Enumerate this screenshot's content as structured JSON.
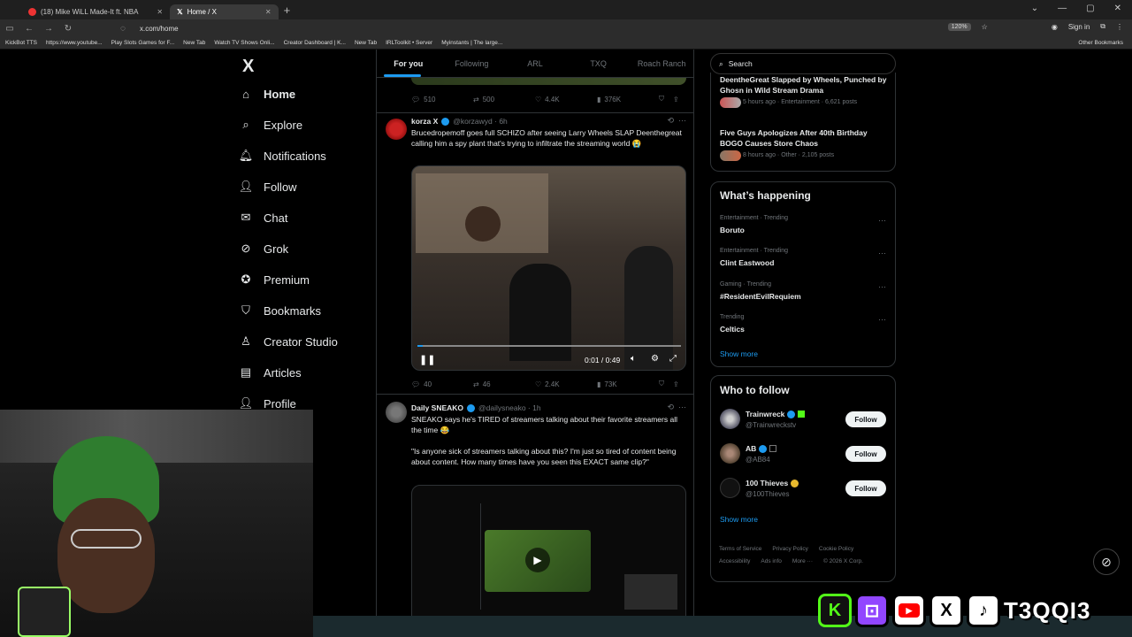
{
  "browser": {
    "tabs": [
      {
        "label": "(18) Mike WiLL Made-It ft. NBA"
      },
      {
        "label": "Home / X"
      }
    ],
    "url": "x.com/home",
    "zoom": "120%",
    "sign_in": "Sign in",
    "bookmarks": [
      "KickBot TTS",
      "https://www.youtube...",
      "Play Slots Games for F...",
      "New Tab",
      "Watch TV Shows Onli...",
      "Creator Dashboard | K...",
      "New Tab",
      "IRLToolkit • Server",
      "Myinstants | The large..."
    ],
    "other_bookmarks": "Other Bookmarks"
  },
  "sidebar": {
    "logo": "X",
    "items": [
      {
        "label": "Home",
        "icon": "home-icon"
      },
      {
        "label": "Explore",
        "icon": "search-icon"
      },
      {
        "label": "Notifications",
        "icon": "bell-icon"
      },
      {
        "label": "Follow",
        "icon": "person-add-icon"
      },
      {
        "label": "Chat",
        "icon": "mail-icon"
      },
      {
        "label": "Grok",
        "icon": "grok-icon"
      },
      {
        "label": "Premium",
        "icon": "premium-icon"
      },
      {
        "label": "Bookmarks",
        "icon": "bookmark-icon"
      },
      {
        "label": "Creator Studio",
        "icon": "creator-icon"
      },
      {
        "label": "Articles",
        "icon": "articles-icon"
      },
      {
        "label": "Profile",
        "icon": "profile-icon"
      }
    ]
  },
  "feed": {
    "tabs": [
      "For you",
      "Following",
      "ARL",
      "TXQ",
      "Roach Ranch"
    ],
    "top_actions": {
      "replies": "510",
      "reposts": "500",
      "likes": "4.4K",
      "views": "376K"
    },
    "post1": {
      "name": "korza X",
      "handle": "@korzawyd · 6h",
      "text": "Brucedropemoff goes full SCHIZO after seeing Larry Wheels SLAP Deenthegreat calling him a spy plant that's trying to infiltrate the streaming world 😭",
      "video_time": "0:01 / 0:49",
      "replies": "40",
      "reposts": "46",
      "likes": "2.4K",
      "views": "73K"
    },
    "post2": {
      "name": "Daily SNEAKO",
      "handle": "@dailysneako · 1h",
      "text": "SNEAKO says he's TIRED of streamers talking about their favorite streamers all the time 😂\n\n\"Is anyone sick of streamers talking about this? I'm just so tired of content being about content. How many times have you seen this EXACT same clip?\""
    }
  },
  "right": {
    "search_placeholder": "Search",
    "news": [
      {
        "title": "DeenthеGreat Slapped by Wheels, Punched by Ghosn in Wild Stream Drama",
        "meta": "5 hours ago · Entertainment · 6,621 posts"
      },
      {
        "title": "Five Guys Apologizes After 40th Birthday BOGO Causes Store Chaos",
        "meta": "8 hours ago · Other · 2,105 posts"
      }
    ],
    "happening_title": "What’s happening",
    "trends": [
      {
        "meta": "Entertainment · Trending",
        "name": "Boruto"
      },
      {
        "meta": "Entertainment · Trending",
        "name": "Clint Eastwood"
      },
      {
        "meta": "Gaming · Trending",
        "name": "#ResidentEvilRequiem"
      },
      {
        "meta": "Trending",
        "name": "Celtics"
      }
    ],
    "show_more": "Show more",
    "wtf_title": "Who to follow",
    "wtf": [
      {
        "name": "Trainwreck",
        "handle": "@Trainwreckstv"
      },
      {
        "name": "AB",
        "handle": "@AB84"
      },
      {
        "name": "100 Thieves",
        "handle": "@100Thieves"
      }
    ],
    "follow_label": "Follow",
    "footer": [
      "Terms of Service",
      "Privacy Policy",
      "Cookie Policy",
      "Accessibility",
      "Ads info",
      "More ···",
      "© 2026 X Corp."
    ]
  },
  "overlay": {
    "brand": "T3QQI3"
  },
  "colors": {
    "accent": "#1d9bf0",
    "kick": "#53fc18",
    "twitch": "#9146ff",
    "youtube": "#ff0000"
  }
}
